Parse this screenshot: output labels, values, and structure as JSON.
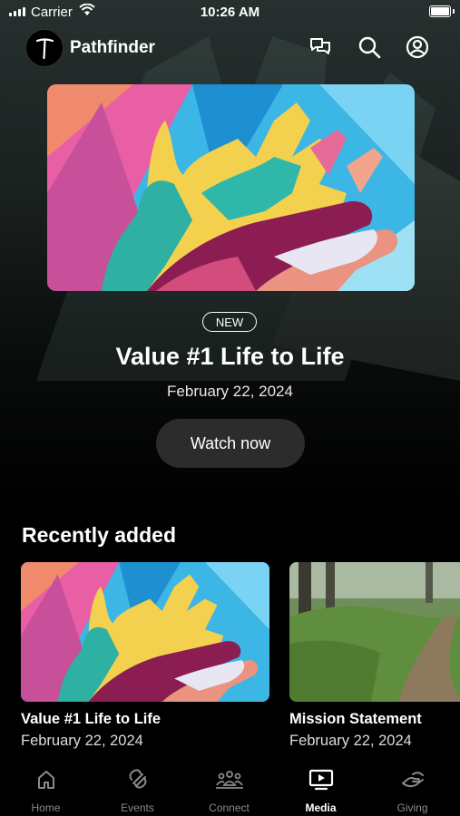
{
  "status_bar": {
    "carrier": "Carrier",
    "time": "10:26 AM"
  },
  "header": {
    "app_name": "Pathfinder"
  },
  "hero": {
    "badge": "NEW",
    "title": "Value #1 Life to Life",
    "date": "February 22, 2024",
    "button_label": "Watch now"
  },
  "recently_added": {
    "title": "Recently added",
    "items": [
      {
        "title": "Value #1 Life to Life",
        "date": "February 22, 2024"
      },
      {
        "title": "Mission Statement",
        "date": "February 22, 2024"
      }
    ]
  },
  "tabs": [
    {
      "label": "Home",
      "icon": "home-icon"
    },
    {
      "label": "Events",
      "icon": "events-icon"
    },
    {
      "label": "Connect",
      "icon": "connect-icon"
    },
    {
      "label": "Media",
      "icon": "media-icon",
      "active": true
    },
    {
      "label": "Giving",
      "icon": "giving-icon"
    }
  ],
  "colors": {
    "background": "#000000",
    "button_bg": "#2c2c2c",
    "inactive_tab": "#8a8a8a"
  }
}
